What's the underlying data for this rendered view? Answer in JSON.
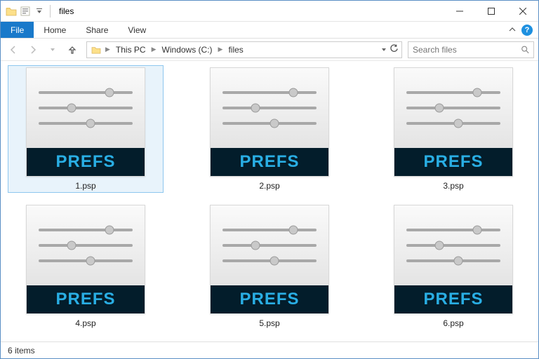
{
  "window": {
    "title": "files"
  },
  "ribbon": {
    "file_label": "File",
    "tabs": [
      "Home",
      "Share",
      "View"
    ]
  },
  "breadcrumbs": {
    "items": [
      "This PC",
      "Windows (C:)",
      "files"
    ]
  },
  "search": {
    "placeholder": "Search files"
  },
  "files": [
    {
      "name": "1.psp",
      "icon_label": "PREFS",
      "selected": true
    },
    {
      "name": "2.psp",
      "icon_label": "PREFS",
      "selected": false
    },
    {
      "name": "3.psp",
      "icon_label": "PREFS",
      "selected": false
    },
    {
      "name": "4.psp",
      "icon_label": "PREFS",
      "selected": false
    },
    {
      "name": "5.psp",
      "icon_label": "PREFS",
      "selected": false
    },
    {
      "name": "6.psp",
      "icon_label": "PREFS",
      "selected": false
    }
  ],
  "status": {
    "item_count_text": "6 items"
  }
}
